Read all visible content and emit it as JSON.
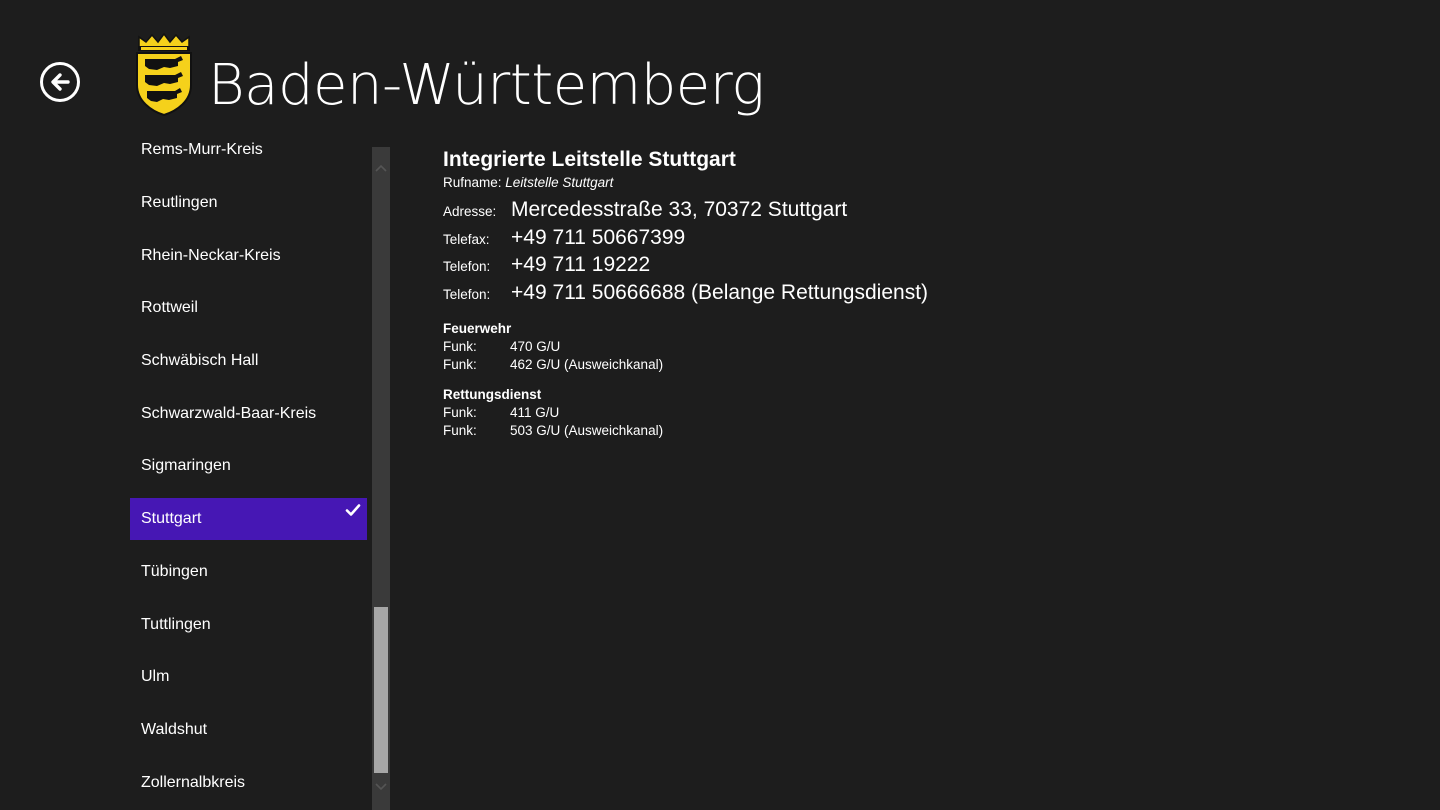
{
  "header": {
    "title": "Baden-Württemberg",
    "back_icon": "back-arrow-icon",
    "crest_icon": "coat-of-arms-icon",
    "crest_colors": {
      "shield": "#f5d11b",
      "lions": "#111111",
      "outline": "#000000"
    }
  },
  "sidebar": {
    "selected_color": "#4617b4",
    "items": [
      {
        "label": "Rems-Murr-Kreis"
      },
      {
        "label": "Reutlingen"
      },
      {
        "label": "Rhein-Neckar-Kreis"
      },
      {
        "label": "Rottweil"
      },
      {
        "label": "Schwäbisch Hall"
      },
      {
        "label": "Schwarzwald-Baar-Kreis"
      },
      {
        "label": "Sigmaringen"
      },
      {
        "label": "Stuttgart",
        "selected": true
      },
      {
        "label": "Tübingen"
      },
      {
        "label": "Tuttlingen"
      },
      {
        "label": "Ulm"
      },
      {
        "label": "Waldshut"
      },
      {
        "label": "Zollernalbkreis"
      }
    ]
  },
  "detail": {
    "heading": "Integrierte Leitstelle Stuttgart",
    "rufname_label": "Rufname:",
    "rufname_value": "Leitstelle Stuttgart",
    "contacts": [
      {
        "label": "Adresse:",
        "value": "Mercedesstraße 33, 70372 Stuttgart"
      },
      {
        "label": "Telefax:",
        "value": "+49 711 50667399"
      },
      {
        "label": "Telefon:",
        "value": "+49 711 19222"
      },
      {
        "label": "Telefon:",
        "value": "+49 711 50666688 (Belange Rettungsdienst)"
      }
    ],
    "sections": [
      {
        "title": "Feuerwehr",
        "rows": [
          {
            "label": "Funk:",
            "value": "470 G/U"
          },
          {
            "label": "Funk:",
            "value": "462 G/U (Ausweichkanal)"
          }
        ]
      },
      {
        "title": "Rettungsdienst",
        "rows": [
          {
            "label": "Funk:",
            "value": "411 G/U"
          },
          {
            "label": "Funk:",
            "value": "503 G/U (Ausweichkanal)"
          }
        ]
      }
    ]
  }
}
